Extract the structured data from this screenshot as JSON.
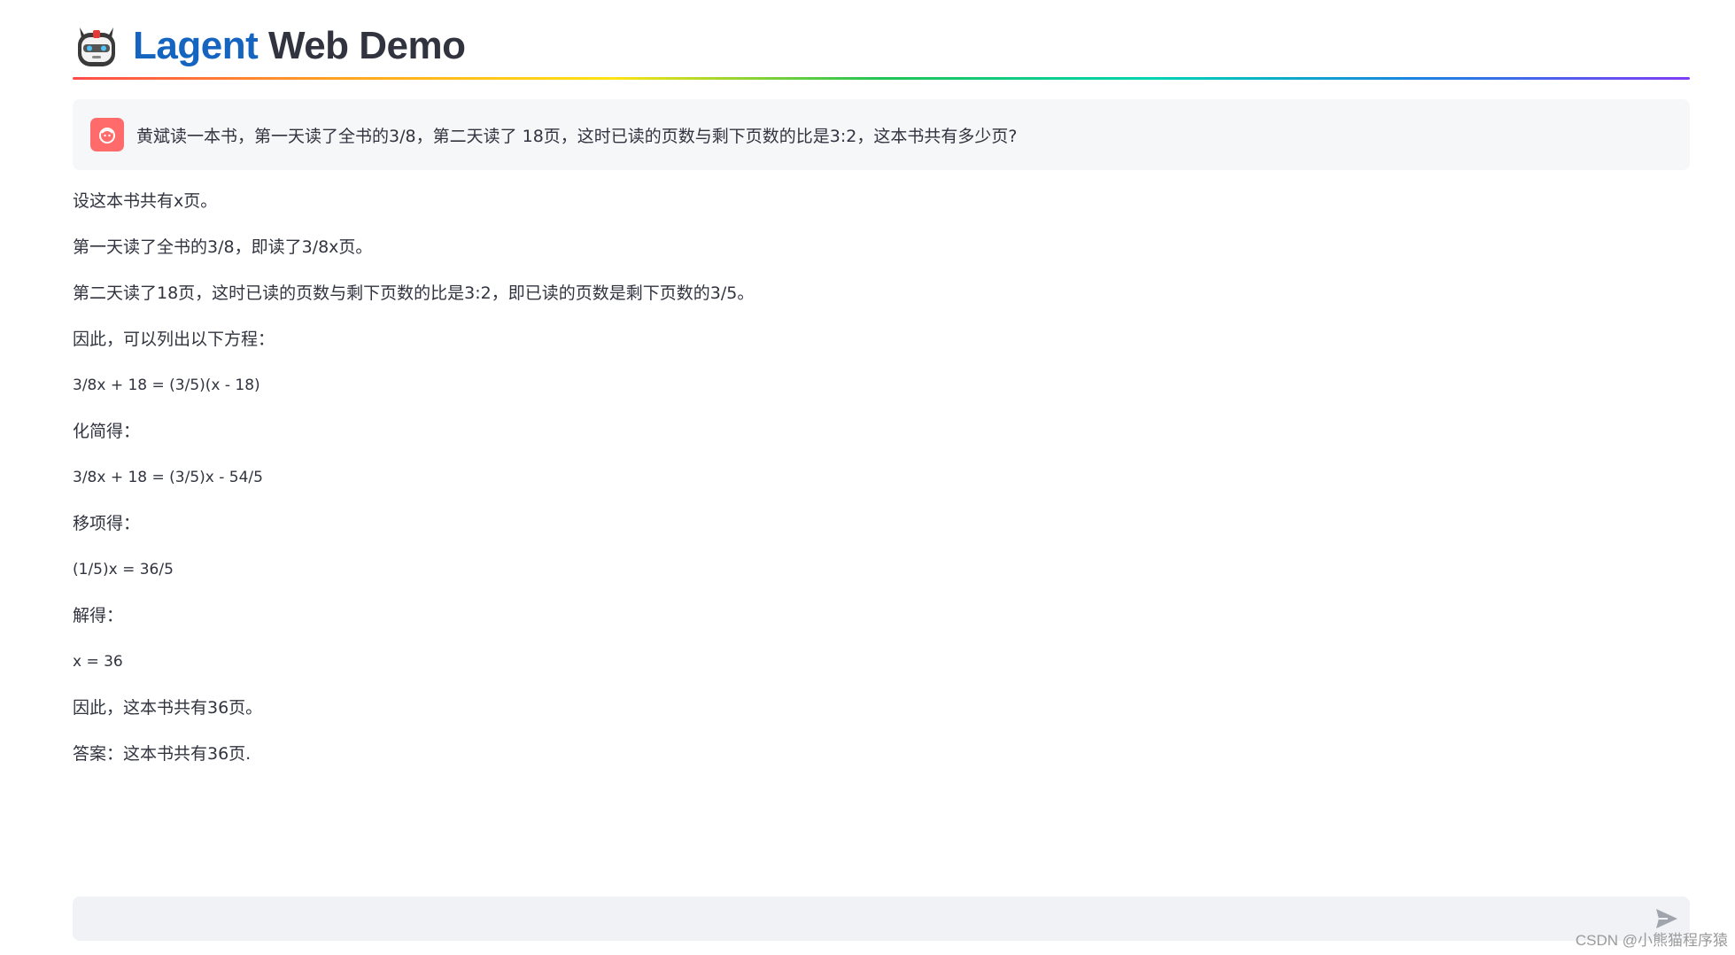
{
  "header": {
    "logo_icon": "robot-icon",
    "title_brand": "Lagent",
    "title_rest": "Web Demo"
  },
  "user_message": {
    "avatar_icon": "user-avatar-icon",
    "text": "黄斌读一本书，第一天读了全书的3/8，第二天读了 18页，这时已读的页数与剩下页数的比是3:2，这本书共有多少页?"
  },
  "assistant_message": {
    "lines": [
      "设这本书共有x页。",
      "第一天读了全书的3/8，即读了3/8x页。",
      "第二天读了18页，这时已读的页数与剩下页数的比是3:2，即已读的页数是剩下页数的3/5。",
      "因此，可以列出以下方程：",
      "3/8x + 18 = (3/5)(x - 18)",
      "化简得：",
      "3/8x + 18 = (3/5)x - 54/5",
      "移项得：",
      "(1/5)x = 36/5",
      "解得：",
      "x = 36",
      "因此，这本书共有36页。",
      "答案：这本书共有36页."
    ]
  },
  "chat_input": {
    "placeholder": "",
    "send_icon": "send-icon"
  },
  "watermark": "CSDN @小熊猫程序猿",
  "colors": {
    "brand": "#1565c0",
    "avatar_bg": "#ff6b6b",
    "message_bg": "#f6f7f9",
    "input_bg": "#f0f2f6"
  }
}
